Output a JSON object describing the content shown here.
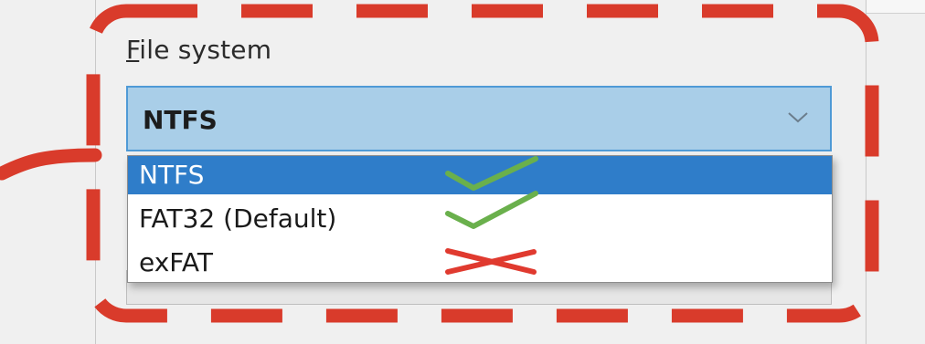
{
  "file_system": {
    "label_mnemonic": "F",
    "label_rest": "ile system",
    "selected_value": "NTFS",
    "options": [
      {
        "label": "NTFS",
        "selected": true
      },
      {
        "label": "FAT32 (Default)",
        "selected": false
      },
      {
        "label": "exFAT",
        "selected": false
      }
    ]
  },
  "annotations": {
    "highlight_color": "#d93b2b",
    "ok_color": "#6ab04c",
    "bad_color": "#e03a2f",
    "marks": [
      {
        "option": "NTFS",
        "mark": "check-icon"
      },
      {
        "option": "FAT32 (Default)",
        "mark": "check-icon"
      },
      {
        "option": "exFAT",
        "mark": "cross-icon"
      }
    ]
  },
  "icons": {
    "combo_arrow": "chevron-down-icon"
  }
}
